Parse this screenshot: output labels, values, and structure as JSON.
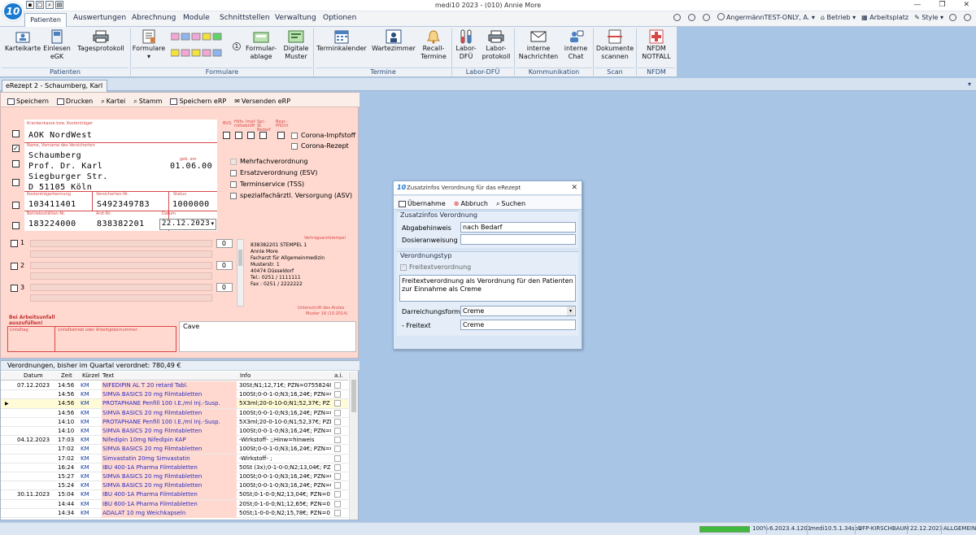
{
  "window": {
    "title": "medi10 2023 - (010) Annie More",
    "logo": "10"
  },
  "menu": {
    "tabs": [
      "Patienten",
      "Auswertungen",
      "Abrechnung",
      "Module",
      "Schnittstellen",
      "Verwaltung",
      "Optionen"
    ],
    "user": "AngermännTEST-ONLY, A.",
    "betrieb": "Betrieb",
    "arbeitsplatz": "Arbeitsplatz",
    "style": "Style"
  },
  "ribbon": {
    "buttons": {
      "karteikarte": "Karteikarte",
      "einlesen": "Einlesen",
      "egk": "eGK",
      "tagesprotokoll": "Tagesprotokoll",
      "formulare": "Formulare",
      "formularablage1": "Formular-",
      "formularablage2": "ablage",
      "digitale1": "Digitale",
      "digitale2": "Muster",
      "terminkalender": "Terminkalender",
      "wartezimmer": "Wartezimmer",
      "recall1": "Recall-",
      "recall2": "Termine",
      "labor1": "Labor-",
      "labor2": "DFÜ",
      "laborprot1": "Labor-",
      "laborprot2": "protokoll",
      "interne1": "interne",
      "interne2": "Nachrichten",
      "chat1": "interne",
      "chat2": "Chat",
      "doku1": "Dokumente",
      "doku2": "scannen",
      "nfdm1": "NFDM",
      "nfdm2": "NOTFALL"
    },
    "groups": {
      "patienten": "Patienten",
      "formulare": "Formulare",
      "termine": "Termine",
      "labor": "Labor-DFÜ",
      "kommunikation": "Kommunikation",
      "scan": "Scan",
      "nfdm": "NFDM"
    }
  },
  "doctab": "eRezept 2 - Schaumberg, Karl",
  "erx": {
    "toolbar": [
      "Speichern",
      "Drucken",
      "Kartei",
      "Stamm",
      "Speichern eRP",
      "Versenden eRP"
    ],
    "labels": {
      "kasse": "Krankenkasse bzw. Kostenträger",
      "name": "Name, Vorname des Versicherten",
      "kostentraeger": "Kostenträgerkennung",
      "versicherten": "Versicherten-Nr.",
      "status": "Status",
      "betrieb": "Betriebsstätten-Nr.",
      "arzt": "Arzt-Nr.",
      "datum": "Datum",
      "geb": "geb. am",
      "bvg": "BVG",
      "hilfs": "Hilfs- mittel",
      "impf": "Impf- stoff",
      "spr": "Spr.-St. Bedarf",
      "beg": "Begr.- Pflicht",
      "vertragsarzt": "Vertragsarztstempel",
      "unterschrift": "Unterschrift des Arztes",
      "muster": "Muster 16 (10.2014)",
      "unfallheading": "Bei Arbeitsunfall auszufüllen!",
      "unfalltag": "Unfalltag",
      "unfallbetrieb": "Unfallbetrieb oder Arbeitgebernummer"
    },
    "kasse": "AOK NordWest",
    "name_lines": [
      "Schaumberg",
      "Prof. Dr. Karl",
      "Siegburger Str.",
      "D 51105 Köln"
    ],
    "geb": "01.06.00",
    "kostentraeger": "103411401",
    "versicherten": "S492349783",
    "status": "1000000",
    "betrieb": "183224000",
    "arzt": "838382201",
    "datum": "22.12.2023",
    "options": [
      "Corona-Impfstoff",
      "Corona-Rezept",
      "Mehrfachverordnung",
      "Ersatzverordnung (ESV)",
      "Terminservice (TSS)",
      "spezialfachärztl. Versorgung (ASV)"
    ],
    "med_numbers": [
      "1",
      "2",
      "3"
    ],
    "spin_value": "0",
    "stamp": [
      "838382201 STEMPEL 1",
      "Annie More",
      "Facharzt für Allgemeinmedizin",
      "Musterstr. 1",
      "40474 Düsseldorf",
      "Tel.: 0251 / 1111111",
      "Fax : 0251 / 2222222"
    ],
    "cave": "Cave"
  },
  "rxlist": {
    "title": "Verordnungen, bisher im Quartal verordnet: 780,49 €",
    "headers": {
      "datum": "Datum",
      "zeit": "Zeit",
      "kuerzel": "Kürzel",
      "text": "Text",
      "info": "Info",
      "ai": "a.i."
    },
    "rows": [
      {
        "d": "07.12.2023",
        "t": "14:56",
        "k": "KM",
        "x": "NIFEDIPIN AL T 20 retard Tabl.",
        "i": "30St;N1;12,71€; PZN=07558248"
      },
      {
        "d": "",
        "t": "14:56",
        "k": "KM",
        "x": "SIMVA BASICS 20 mg Filmtabletten",
        "i": "100St;0-0-1-0;N3;16,24€; PZN=0"
      },
      {
        "d": "",
        "t": "14:56",
        "k": "KM",
        "x": "PROTAPHANE Penfill 100 I.E./ml Inj.-Susp.",
        "i": "5X3ml;20-0-10-0;N1;52,37€; PZ"
      },
      {
        "d": "",
        "t": "14:56",
        "k": "KM",
        "x": "SIMVA BASICS 20 mg Filmtabletten",
        "i": "100St;0-0-1-0;N3;16,24€; PZN=0"
      },
      {
        "d": "",
        "t": "14:10",
        "k": "KM",
        "x": "PROTAPHANE Penfill 100 I.E./ml Inj.-Susp.",
        "i": "5X3ml;20-0-10-0;N1;52,37€; PZN"
      },
      {
        "d": "",
        "t": "14:10",
        "k": "KM",
        "x": "SIMVA BASICS 20 mg Filmtabletten",
        "i": "100St;0-0-1-0;N3;16,24€; PZN=0"
      },
      {
        "d": "04.12.2023",
        "t": "17:03",
        "k": "KM",
        "x": "Nifedipin 10mg Nifedipin KAP",
        "i": "-Wirkstoff- ;;Hinw=hinweis"
      },
      {
        "d": "",
        "t": "17:02",
        "k": "KM",
        "x": "SIMVA BASICS 20 mg Filmtabletten",
        "i": "100St;0-0-1-0;N3;16,24€; PZN=0"
      },
      {
        "d": "",
        "t": "17:02",
        "k": "KM",
        "x": "Simvastatin 20mg Simvastatin",
        "i": "-Wirkstoff- ;"
      },
      {
        "d": "",
        "t": "16:24",
        "k": "KM",
        "x": "IBU 400-1A Pharma Filmtabletten",
        "i": "50St (3x);0-1-0-0;N2;13,04€; PZ"
      },
      {
        "d": "",
        "t": "15:27",
        "k": "KM",
        "x": "SIMVA BASICS 20 mg Filmtabletten",
        "i": "100St;0-0-1-0;N3;16,24€; PZN=0"
      },
      {
        "d": "",
        "t": "15:24",
        "k": "KM",
        "x": "SIMVA BASICS 20 mg Filmtabletten",
        "i": "100St;0-0-1-0;N3;16,24€; PZN=0"
      },
      {
        "d": "30.11.2023",
        "t": "15:04",
        "k": "KM",
        "x": "IBU 400-1A Pharma Filmtabletten",
        "i": "50St;0-1-0-0;N2;13,04€; PZN=0"
      },
      {
        "d": "",
        "t": "14:44",
        "k": "KM",
        "x": "IBU 600-1A Pharma Filmtabletten",
        "i": "20St;0-1-0-0;N1;12,65€; PZN=0"
      },
      {
        "d": "",
        "t": "14:34",
        "k": "KM",
        "x": "ADALAT 10 mg Weichkapseln",
        "i": "50St;1-0-0-0;N2;15,78€; PZN=0"
      }
    ]
  },
  "dialog": {
    "title": "Zusatzinfos Verordnung für das eRezept",
    "toolbar": [
      "Übernahme",
      "Abbruch",
      "Suchen"
    ],
    "section1": "Zusatzinfos Verordnung",
    "abgabehinweis_label": "Abgabehinweis",
    "abgabehinweis_value": "nach Bedarf",
    "dosier_label": "Dosieranweisung",
    "dosier_value": "",
    "section2": "Verordnungstyp",
    "freitext_cb": "Freitextverordnung",
    "freitext_area": "Freitextverordnung als Verordnung für den Patienten zur Einnahme als Creme",
    "darreichung_label": "Darreichungsform",
    "darreichung_value": "Creme",
    "freitext_label": "- Freitext",
    "freitext_value": "Creme"
  },
  "status": {
    "percent": "100%",
    "progress": 1.0,
    "version": "6.2023.4.1201",
    "host": "medi10.5.1.34sp1",
    "place": "UFP-KIRSCHBAUM",
    "date": "22.12.2023",
    "mode": "ALLGEMEIN"
  }
}
